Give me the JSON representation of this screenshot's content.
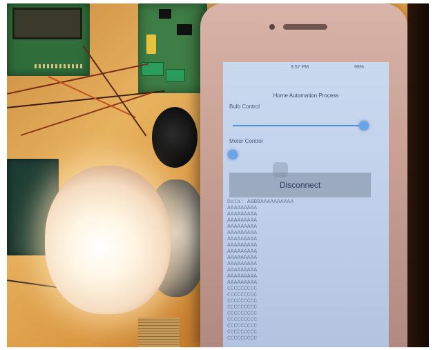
{
  "scene": {
    "description_tags": [
      "lcd-board",
      "relay-board",
      "speaker",
      "light-bulb",
      "smartphone"
    ]
  },
  "phone": {
    "status": {
      "carrier": "",
      "time": "3:57 PM",
      "battery": "99%"
    },
    "app": {
      "title": "Home Automation Process",
      "bulb_label": "Bulb Control",
      "bulb_value": 1.0,
      "motor_label": "Motor Control",
      "motor_value": 0.0,
      "disconnect_label": "Disconnect",
      "log_lines": [
        "Data: ABBBAAAAAAAAAA",
        "AAAAAAAAA",
        "AAAAAAAAA",
        "AAAAAAAAA",
        "AAAAAAAAA",
        "AAAAAAAAA",
        "AAAAAAAAA",
        "AAAAAAAAA",
        "AAAAAAAAA",
        "AAAAAAAAA",
        "AAAAAAAAA",
        "AAAAAAAAA",
        "AAAAAAAAA",
        "AAAAAAAAA",
        "CCCCCCCCC",
        "CCCCCCCCC",
        "CCCCCCCCC",
        "CCCCCCCCC",
        "CCCCCCCCC",
        "CCCCCCCCC",
        "CCCCCCCCC",
        "CCCCCCCCC",
        "CCCCCCCCC"
      ]
    },
    "colors": {
      "accent": "#4f8fd6",
      "button": "#9ba9c1"
    }
  }
}
